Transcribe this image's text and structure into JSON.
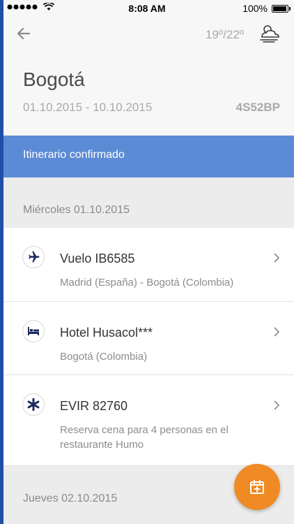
{
  "status_bar": {
    "time": "8:08 AM",
    "battery": "100%",
    "battery_level": 1.0
  },
  "header": {
    "temperature": "19º/22º",
    "city": "Bogotá",
    "dates": "01.10.2015 - 10.10.2015",
    "booking_code": "4S52BP"
  },
  "confirmation": {
    "label": "Itinerario confirmado",
    "color": "#5b8bd4"
  },
  "days": [
    {
      "label": "Miércoles 01.10.2015",
      "items": [
        {
          "icon": "plane-icon",
          "title": "Vuelo IB6585",
          "subtitle": "Madrid (España) - Bogotá (Colombia)"
        },
        {
          "icon": "bed-icon",
          "title": "Hotel Husacol***",
          "subtitle": "Bogotá (Colombia)"
        },
        {
          "icon": "asterisk-icon",
          "title": "EVIR 82760",
          "subtitle": "Reserva cena para 4 personas en el restaurante Humo"
        }
      ]
    },
    {
      "label": "Jueves 02.10.2015",
      "items": []
    }
  ],
  "colors": {
    "accent_blue": "#1f4fa6",
    "fab_orange": "#f08a24",
    "icon_navy": "#1c2a5c"
  },
  "fab": {
    "icon": "calendar-add-icon"
  }
}
